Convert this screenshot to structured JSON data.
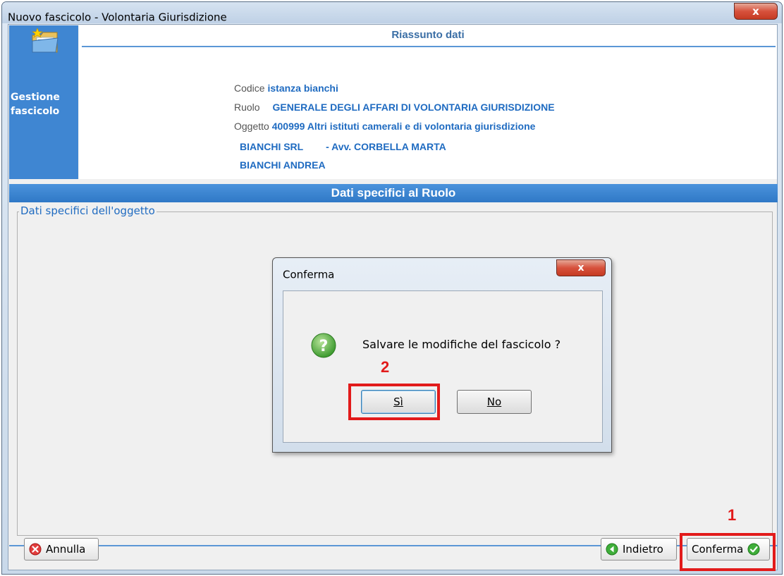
{
  "window": {
    "title": "Nuovo fascicolo - Volontaria Giurisdizione",
    "close_label": "x"
  },
  "side": {
    "label_line1": "Gestione",
    "label_line2": "fascicolo",
    "icon": "folder-star-icon"
  },
  "summary": {
    "title": "Riassunto dati",
    "codice_label": "Codice",
    "codice_value": "istanza bianchi",
    "ruolo_label": "Ruolo",
    "ruolo_value": "GENERALE DEGLI AFFARI DI VOLONTARIA GIURISDIZIONE",
    "oggetto_label": "Oggetto",
    "oggetto_value": "400999 Altri istituti camerali e di volontaria giurisdizione",
    "party1": "BIANCHI SRL",
    "lawyer1": "- Avv. CORBELLA MARTA",
    "party2": "BIANCHI ANDREA"
  },
  "section_title": "Dati specifici al Ruolo",
  "group_legend": "Dati specifici dell'oggetto",
  "buttons": {
    "annulla": "Annulla",
    "indietro": "Indietro",
    "conferma": "Conferma"
  },
  "dialog": {
    "title": "Conferma",
    "close_label": "x",
    "message": "Salvare le modifiche del fascicolo ?",
    "yes_label": "Sì",
    "no_label": "No",
    "icon": "question-icon"
  },
  "annotations": {
    "step1": "1",
    "step2": "2",
    "highlight_color": "#e21b1b"
  },
  "colors": {
    "accent_blue": "#3f86d2",
    "value_blue": "#1f6bc1",
    "title_blue": "#3a6ea5"
  }
}
